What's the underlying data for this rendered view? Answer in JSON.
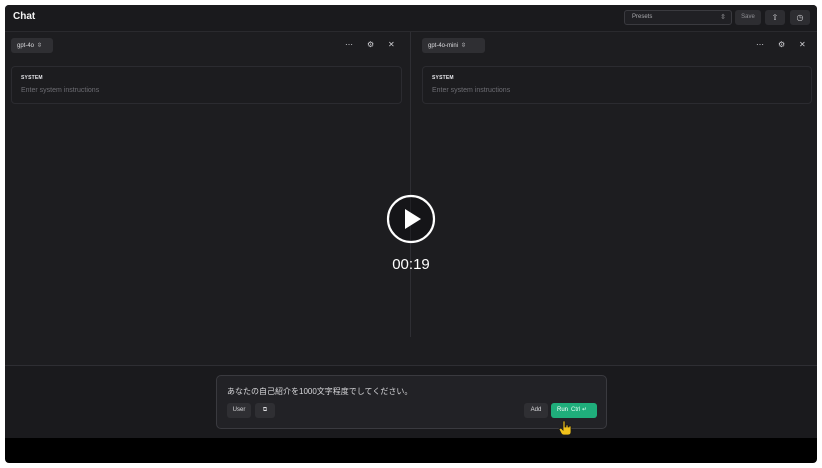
{
  "app": {
    "title": "Chat",
    "presets": {
      "label": "Presets"
    },
    "save_label": "Save",
    "icons": [
      "upload-icon",
      "history-icon"
    ]
  },
  "panes": [
    {
      "model": "gpt-4o",
      "system_label": "SYSTEM",
      "system_placeholder": "Enter system instructions"
    },
    {
      "model": "gpt-4o-mini",
      "system_label": "SYSTEM",
      "system_placeholder": "Enter system instructions"
    }
  ],
  "composer": {
    "message": "あなたの自己紹介を1000文字程度でしてください。",
    "role_label": "User",
    "add_label": "Add",
    "run_label": "Run",
    "run_shortcut": "Ctrl ↵"
  },
  "video": {
    "time": "00:19"
  },
  "colors": {
    "accent": "#1fae7b",
    "background": "#1d1d20"
  }
}
